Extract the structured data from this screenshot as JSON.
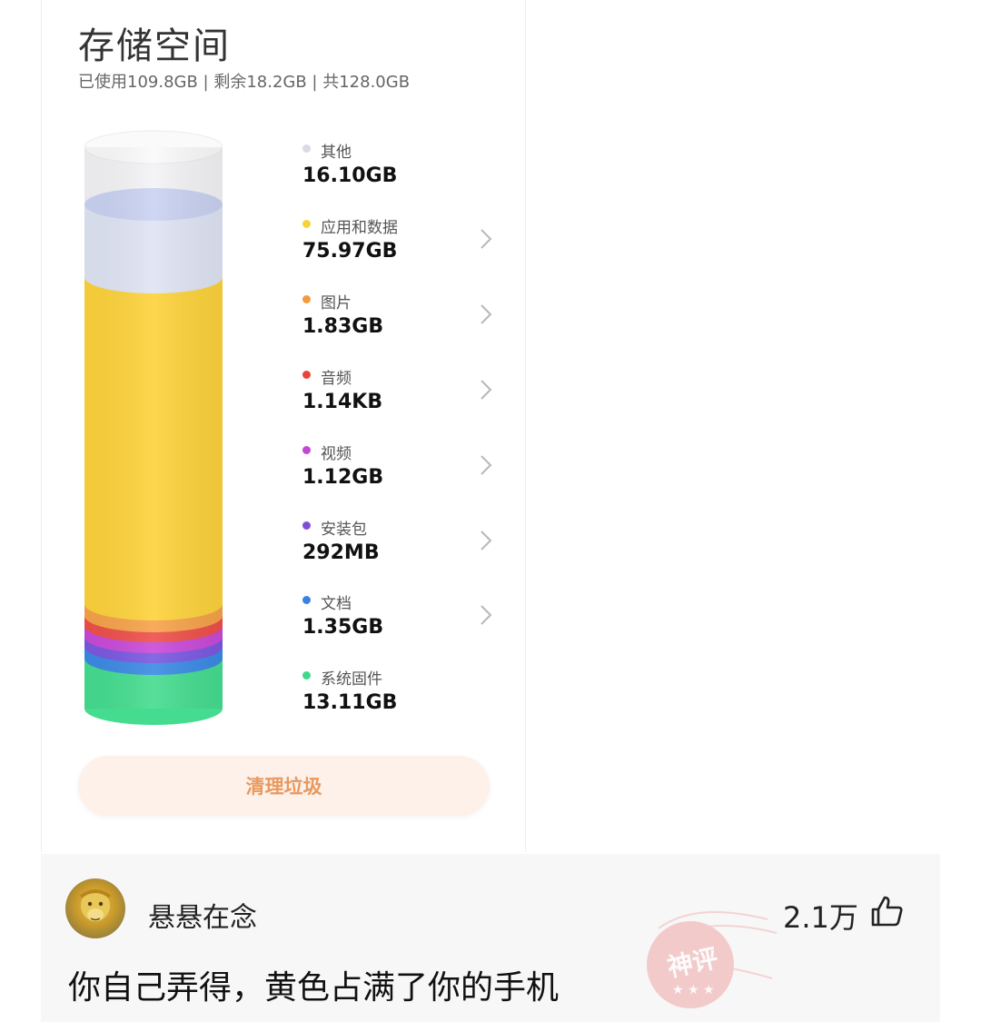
{
  "storage": {
    "title": "存储空间",
    "summary": "已使用109.8GB | 剩余18.2GB | 共128.0GB",
    "categories": [
      {
        "label": "其他",
        "value": "16.10GB",
        "color": "#dde2ef",
        "has_chevron": false
      },
      {
        "label": "应用和数据",
        "value": "75.97GB",
        "color": "#f5d43a",
        "has_chevron": true
      },
      {
        "label": "图片",
        "value": "1.83GB",
        "color": "#f39a3c",
        "has_chevron": true
      },
      {
        "label": "音频",
        "value": "1.14KB",
        "color": "#e8443a",
        "has_chevron": true
      },
      {
        "label": "视频",
        "value": "1.12GB",
        "color": "#c446d6",
        "has_chevron": true
      },
      {
        "label": "安装包",
        "value": "292MB",
        "color": "#7d4fd9",
        "has_chevron": true
      },
      {
        "label": "文档",
        "value": "1.35GB",
        "color": "#3b82e0",
        "has_chevron": true
      },
      {
        "label": "系统固件",
        "value": "13.11GB",
        "color": "#3fd98b",
        "has_chevron": false
      }
    ],
    "clean_button": "清理垃圾"
  },
  "comment": {
    "username": "悬悬在念",
    "likes": "2.1万",
    "text": "你自己弄得，黄色占满了你的手机",
    "stamp_text": "神评"
  }
}
